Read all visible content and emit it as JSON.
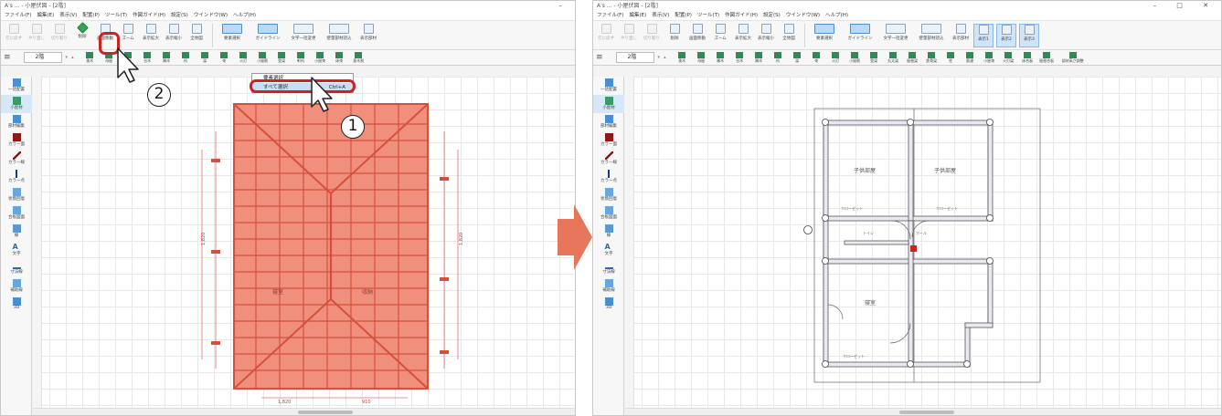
{
  "left_window": {
    "title": "A's ... - 小屋伏図 - [2階]",
    "menu": [
      "ファイル(F)",
      "編集(E)",
      "表示(V)",
      "配置(P)",
      "ツール(T)",
      "作図ガイド(H)",
      "設定(S)",
      "ウインドウ(W)",
      "ヘルプ(H)"
    ],
    "floor_select": "2階",
    "toolbar": [
      {
        "label": "元に戻す",
        "state": "disabled"
      },
      {
        "label": "やり直し",
        "state": "disabled"
      },
      {
        "label": "切り取り",
        "state": "disabled"
      },
      {
        "label": "削除",
        "state": "highlighted"
      },
      {
        "label": "画面移動",
        "state": "normal"
      },
      {
        "label": "ズーム",
        "state": "normal"
      },
      {
        "label": "表示拡大",
        "state": "normal"
      },
      {
        "label": "表示縮小",
        "state": "normal"
      },
      {
        "label": "全体図",
        "state": "normal"
      },
      {
        "label": "要素選択",
        "state": "selected"
      },
      {
        "label": "ガイドライン",
        "state": "selected"
      },
      {
        "label": "文字一括変更",
        "state": "normal"
      },
      {
        "label": "壁量部材読込",
        "state": "normal"
      },
      {
        "label": "表示部材",
        "state": "normal"
      }
    ],
    "dropdown": {
      "items": [
        {
          "label": "要素選択",
          "shortcut": ""
        },
        {
          "label": "すべて選択",
          "shortcut": "Ctrl+A"
        }
      ]
    },
    "row2_tools": [
      "垂木",
      "母屋",
      "棟木",
      "谷木",
      "隅木",
      "桁",
      "梁",
      "束",
      "火打",
      "小屋筋",
      "登梁",
      "軒桁",
      "小屋束",
      "床束",
      "垂木割"
    ],
    "leftbar": [
      "一括配置",
      "小屋材",
      "部材編集",
      "カラー面",
      "カラー線",
      "カラー点",
      "状態回復",
      "合板図面",
      "線",
      "文字",
      "寸法線",
      "補助線",
      "3D"
    ],
    "plan_labels": [
      "寝室",
      "収納"
    ],
    "dimension_labels": [
      "1,820",
      "1,820",
      "1,820",
      "910"
    ]
  },
  "right_window": {
    "title": "A's ... - 小屋伏図 - [2階]",
    "menu": [
      "ファイル(F)",
      "編集(E)",
      "表示(V)",
      "配置(P)",
      "ツール(T)",
      "作図ガイド(H)",
      "設定(S)",
      "ウインドウ(W)",
      "ヘルプ(H)"
    ],
    "floor_select": "2階",
    "toolbar": [
      {
        "label": "元に戻す",
        "state": "disabled"
      },
      {
        "label": "やり直し",
        "state": "disabled"
      },
      {
        "label": "切り取り",
        "state": "disabled"
      },
      {
        "label": "削除",
        "state": "normal"
      },
      {
        "label": "画面移動",
        "state": "normal"
      },
      {
        "label": "ズーム",
        "state": "normal"
      },
      {
        "label": "表示拡大",
        "state": "normal"
      },
      {
        "label": "表示縮小",
        "state": "normal"
      },
      {
        "label": "全体図",
        "state": "normal"
      },
      {
        "label": "要素選択",
        "state": "selected"
      },
      {
        "label": "ガイドライン",
        "state": "selected"
      },
      {
        "label": "文字一括変更",
        "state": "normal"
      },
      {
        "label": "壁量部材読込",
        "state": "normal"
      },
      {
        "label": "表示部材",
        "state": "normal"
      },
      {
        "label": "表示1",
        "state": "blue"
      },
      {
        "label": "表示2",
        "state": "blue"
      },
      {
        "label": "表示3",
        "state": "blue"
      }
    ],
    "row2_tools": [
      "垂木",
      "母屋",
      "棟木",
      "谷木",
      "隅木",
      "桁",
      "梁",
      "束",
      "火打",
      "小屋筋",
      "登梁",
      "丸太梁",
      "屋根梁",
      "鉄骨梁",
      "柱",
      "筋違",
      "小屋束",
      "火打梁",
      "床合板",
      "屋根合板",
      "部材高さ調整"
    ],
    "leftbar": [
      "一括配置",
      "小屋材",
      "部材編集",
      "カラー面",
      "カラー線",
      "カラー点",
      "状態回復",
      "合板図面",
      "線",
      "文字",
      "寸法線",
      "補助線",
      "3D"
    ],
    "room_labels": [
      "子供部屋",
      "子供部屋",
      "寝室"
    ],
    "closet_labels": [
      "クローゼット",
      "クローゼット",
      "クローゼット"
    ],
    "small_labels": [
      "トイレ",
      "ホール"
    ]
  },
  "callouts": [
    "1",
    "2"
  ],
  "colors": {
    "selection_fill": "#f0907c",
    "selection_stroke": "#d4503c",
    "highlight_red": "#cc2222",
    "arrow": "#e8765a",
    "accent_blue": "#4a8fd0"
  }
}
